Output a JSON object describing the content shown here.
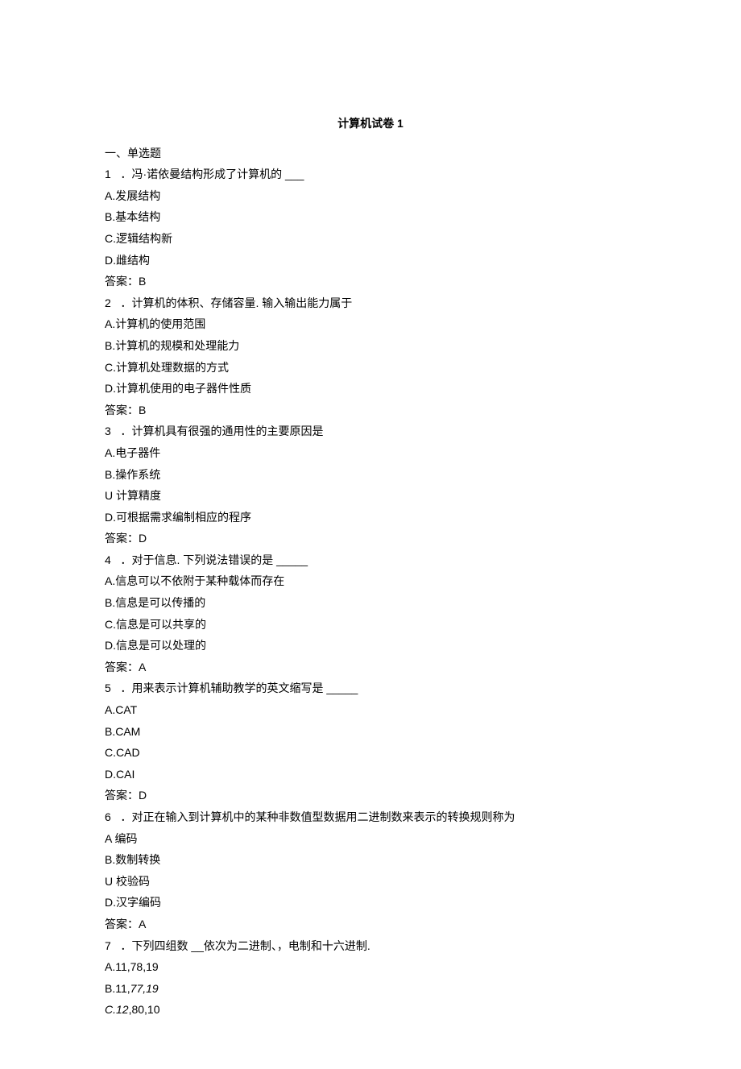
{
  "title": "计算机试卷 1",
  "section": "一、单选题",
  "questions": [
    {
      "num": "1",
      "sep": "．",
      "text": "冯·诺依曼结构形成了计算机的 ___",
      "opts": [
        "A.发展结构",
        "B.基本结构",
        "C.逻辑结构新",
        "D.雌结构"
      ],
      "ans": "答案：B"
    },
    {
      "num": "2",
      "sep": "．",
      "text": "计算机的体积、存储容量. 输入输出能力属于",
      "opts": [
        "A.计算机的使用范围",
        "B.计算机的规模和处理能力",
        "C.计算机处理数据的方式",
        "D.计算机使用的电子器件性质"
      ],
      "ans": "答案：B"
    },
    {
      "num": "3",
      "sep": "．",
      "text": "计算机具有很强的通用性的主要原因是",
      "opts": [
        "A.电子器件",
        "B.操作系统",
        "U 计算精度",
        "D.可根据需求编制相应的程序"
      ],
      "ans": "答案：D"
    },
    {
      "num": "4",
      "sep": "．",
      "text": "对于信息. 下列说法错误的是 _____",
      "opts": [
        "A.信息可以不依附于某种载体而存在",
        "B.信息是可以传播的",
        "C.信息是可以共享的",
        "D.信息是可以处理的"
      ],
      "ans": "答案：A"
    },
    {
      "num": "5",
      "sep": "．",
      "text": "用来表示计算机辅助教学的英文缩写是 _____",
      "opts": [
        "A.CAT",
        "B.CAM",
        "C.CAD",
        "D.CAI"
      ],
      "ans": "答案：D"
    },
    {
      "num": "6",
      "sep": "．",
      "text": "对正在输入到计算机中的某种非数值型数据用二进制数来表示的转换规则称为",
      "opts": [
        "A 编码",
        "B.数制转换",
        "U 校验码",
        "D.汉字编码"
      ],
      "ans": "答案：A"
    },
    {
      "num": "7",
      "sep": "．",
      "text": "下列四组数 __依次为二进制、，电制和十六进制.",
      "opts": [
        "A.11,78,19"
      ],
      "ans": null,
      "extraB": {
        "prefix": "B.11,",
        "italic": "77,19"
      },
      "extraC": {
        "italicPrefix": "C.12",
        "rest": ",80,10"
      }
    }
  ]
}
